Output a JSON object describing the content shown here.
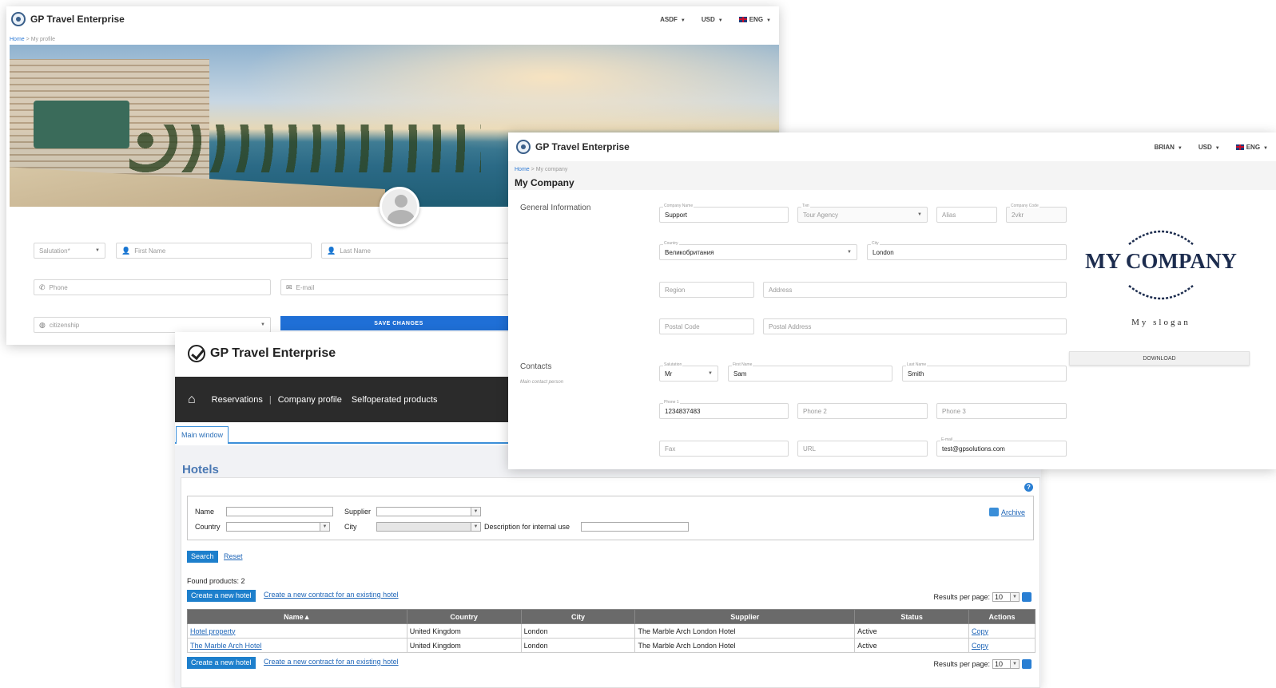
{
  "profile_window": {
    "app_name": "GP Travel Enterprise",
    "header": {
      "user": "ASDF",
      "currency": "USD",
      "language": "ENG"
    },
    "breadcrumb": {
      "home": "Home",
      "separator": ">",
      "current": "My profile"
    },
    "form": {
      "salutation_placeholder": "Salutation*",
      "first_name_placeholder": "First Name",
      "last_name_placeholder": "Last Name",
      "phone_placeholder": "Phone",
      "email_placeholder": "E-mail",
      "citizenship_placeholder": "citizenship",
      "save_button": "SAVE CHANGES"
    }
  },
  "company_window": {
    "app_name": "GP Travel Enterprise",
    "header": {
      "user": "BRIAN",
      "currency": "USD",
      "language": "ENG"
    },
    "breadcrumb": {
      "home": "Home",
      "separator": ">",
      "current": "My company"
    },
    "title": "My Company",
    "general_section": "General Information",
    "contacts_section": "Contacts",
    "contacts_sub": "Main contact person",
    "fields": {
      "company_name": {
        "label": "Company Name",
        "value": "Support"
      },
      "type": {
        "label": "Tип",
        "value": "Tour Agency"
      },
      "alias": {
        "placeholder": "Alias"
      },
      "company_code": {
        "label": "Company Code",
        "value": "2vkr"
      },
      "country": {
        "label": "Country",
        "value": "Великобритания"
      },
      "city": {
        "label": "City",
        "value": "London"
      },
      "region": {
        "placeholder": "Region"
      },
      "address": {
        "placeholder": "Address"
      },
      "postal_code": {
        "placeholder": "Postal Code"
      },
      "postal_address": {
        "placeholder": "Postal Address"
      },
      "salutation": {
        "label": "Salutation",
        "value": "Mr"
      },
      "first_name": {
        "label": "First Name",
        "value": "Sam"
      },
      "last_name": {
        "label": "Last Name",
        "value": "Smith"
      },
      "phone1": {
        "label": "Phone 1",
        "value": "1234837483"
      },
      "phone2": {
        "placeholder": "Phone 2"
      },
      "phone3": {
        "placeholder": "Phone 3"
      },
      "fax": {
        "placeholder": "Fax"
      },
      "url": {
        "placeholder": "URL"
      },
      "email": {
        "label": "E-mail",
        "value": "test@gpsolutions.com"
      }
    },
    "logo_text": "MY COMPANY",
    "slogan": "My slogan",
    "download_button": "DOWNLOAD"
  },
  "hotels_window": {
    "app_name": "GP Travel Enterprise",
    "nav": [
      "Reservations",
      "Company profile",
      "Selfoperated products"
    ],
    "tab": "Main window",
    "title": "Hotels",
    "filters": {
      "name": "Name",
      "supplier": "Supplier",
      "country": "Country",
      "city": "City",
      "description": "Description for internal use",
      "archive": "Archive"
    },
    "search_button": "Search",
    "reset_link": "Reset",
    "found": "Found products: 2",
    "create_button": "Create a new hotel",
    "create_contract_link": "Create a new contract for an existing hotel",
    "results_per_page_label": "Results per page:",
    "results_per_page_value": "10",
    "columns": [
      "Name▲",
      "Country",
      "City",
      "Supplier",
      "Status",
      "Actions"
    ],
    "rows": [
      {
        "name": "Hotel property",
        "country": "United Kingdom",
        "city": "London",
        "supplier": "The Marble Arch London Hotel",
        "status": "Active",
        "action": "Copy"
      },
      {
        "name": "The Marble Arch Hotel",
        "country": "United Kingdom",
        "city": "London",
        "supplier": "The Marble Arch London Hotel",
        "status": "Active",
        "action": "Copy"
      }
    ]
  }
}
